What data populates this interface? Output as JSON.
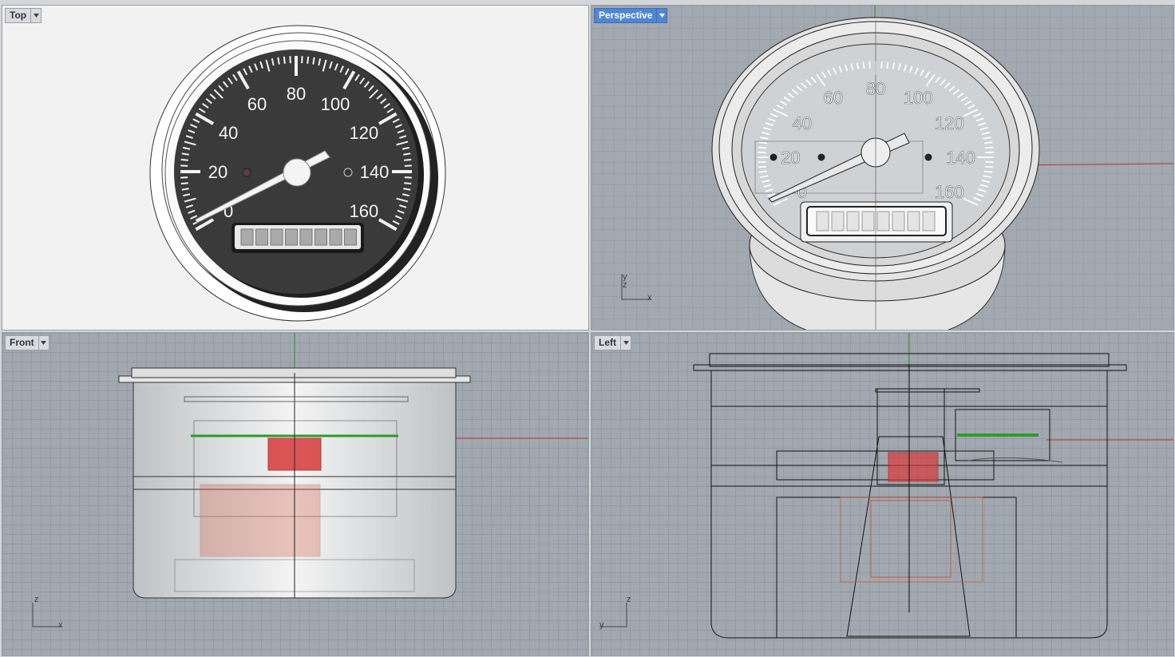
{
  "viewports": {
    "top": {
      "label": "Top",
      "active": false
    },
    "perspective": {
      "label": "Perspective",
      "active": true
    },
    "front": {
      "label": "Front",
      "active": false,
      "axes": {
        "v": "z",
        "h": "x"
      }
    },
    "left": {
      "label": "Left",
      "active": false,
      "axes": {
        "v": "z",
        "h": "y"
      }
    },
    "perspective_axes": {
      "v1": "y",
      "v2": "z",
      "h": "x"
    }
  },
  "gauge": {
    "scale_labels": [
      "0",
      "20",
      "40",
      "60",
      "80",
      "100",
      "120",
      "140",
      "160"
    ],
    "odometer_digits": 8,
    "needle_value": 20
  },
  "colors": {
    "active_tab": "#4f86d4",
    "x_axis": "#c22a2a",
    "y_axis": "#1c9a1c",
    "dial_face": "#353535"
  },
  "icons": {
    "tab_dropdown": "chevron-down-icon",
    "axis_indicator": "axis-icon"
  }
}
